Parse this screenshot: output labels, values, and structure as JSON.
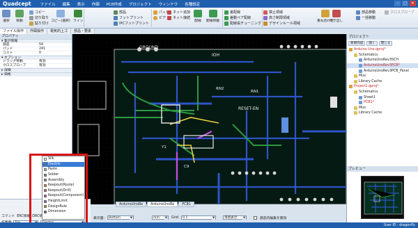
{
  "app": {
    "logo": "Quadcept",
    "menu": [
      "ファイル",
      "編集",
      "表示",
      "作図",
      "PCB作成",
      "プロジェクト",
      "ウィンドウ",
      "各種設定"
    ]
  },
  "ribbon": {
    "groups": [
      {
        "label": "選択"
      },
      {
        "label": "移動"
      },
      {
        "label": "コピー"
      },
      {
        "label": "切り取り"
      },
      {
        "label": "貼り付け"
      },
      {
        "label": "コピー(選択)"
      },
      {
        "label": "ライン"
      },
      {
        "label": "部品"
      },
      {
        "label": "フットプリント"
      },
      {
        "label": "IPCフットプリント"
      },
      {
        "label": "パッド"
      },
      {
        "label": "ビア"
      },
      {
        "label": "ネット追加"
      },
      {
        "label": "ネット接続"
      },
      {
        "label": "配線"
      },
      {
        "label": "配線移動"
      },
      {
        "label": "差配線"
      },
      {
        "label": "差動ペア配線"
      },
      {
        "label": "配線長チューニング"
      },
      {
        "label": "禁止領域"
      },
      {
        "label": "高さ制限領域"
      },
      {
        "label": "デザインルール領域"
      },
      {
        "label": "重ね合わせ"
      },
      {
        "label": "引き出し"
      },
      {
        "label": "部品移動"
      },
      {
        "label": "一括移動"
      },
      {
        "label": "クロスプローブ"
      }
    ]
  },
  "tabs": [
    "ファイル操作",
    "作図操作",
    "電気的上ゴ",
    "部品・要素"
  ],
  "properties": {
    "title": "プロパティ",
    "sections": [
      {
        "name": "集計情報",
        "rows": [
          {
            "k": "部品",
            "v": "54"
          },
          {
            "k": "パッド",
            "v": "241"
          },
          {
            "k": "コスト",
            "v": "0"
          }
        ]
      },
      {
        "name": "オプション",
        "rows": [
          {
            "k": "ドラッグ移動",
            "v": "有効"
          },
          {
            "k": "クロスプローブ",
            "v": "有効"
          }
        ]
      },
      {
        "name": "詳細",
        "rows": []
      },
      {
        "name": "価格",
        "rows": []
      }
    ]
  },
  "layer_dropdown": {
    "items": [
      "Silk",
      "Electric",
      "Paste",
      "Solder",
      "Assembly",
      "Keepout(Route)",
      "Keepout(Drill)",
      "Keepout(Component)",
      "HeightLimit",
      "DesignRule",
      "Dimension"
    ],
    "selected": "Electric",
    "swatch_colors": [
      "#ffffff",
      "#3a7bd5",
      "#b0b0b0",
      "#5b9b5b",
      "#909090",
      "#e38a2a",
      "#d65b5b",
      "#d64ea0",
      "#8c6cc7",
      "#c28f2d",
      "#6a6a6a"
    ]
  },
  "bottom_left": {
    "row1": [
      "コマンド",
      "ERC情報",
      "DRC情報",
      "MRC情報"
    ],
    "face_label": "作業面",
    "face_value": "Top",
    "layer_value": "Electric"
  },
  "doc_tabs": [
    "ArduinoUnoRe",
    "ArduinoUnoRe",
    "PCB1"
  ],
  "status": {
    "layer_label": "表示面:",
    "layer_value": "Bottom",
    "unit": "mm",
    "grid_label": "Grid",
    "grid_value": "0.1",
    "mode": "単新表示",
    "edit_label": "部品内編集を無効"
  },
  "bottombar": {
    "user": "User ID : dragonfly"
  },
  "project": {
    "title": "プロジェクト",
    "tools": [
      "新規作成",
      "開く",
      "閉じる"
    ],
    "tree": [
      {
        "text": "Arduino Uno.qproj*",
        "indent": 0,
        "red": true,
        "sel": false
      },
      {
        "text": "Schematics",
        "indent": 1,
        "red": false,
        "sel": false
      },
      {
        "text": "ArduinoUnoRev3SCH",
        "indent": 2,
        "red": false,
        "sel": false
      },
      {
        "text": "ArduinoUnoRev3PCB*",
        "indent": 2,
        "red": true,
        "sel": true
      },
      {
        "text": "ArduinoUnoRev3PCB_Panel",
        "indent": 2,
        "red": false,
        "sel": false
      },
      {
        "text": "Misc",
        "indent": 1,
        "red": false,
        "sel": false
      },
      {
        "text": "Library Cache",
        "indent": 1,
        "red": false,
        "sel": false
      },
      {
        "text": "Project1.qproj*",
        "indent": 0,
        "red": true,
        "sel": false
      },
      {
        "text": "Schematics",
        "indent": 1,
        "red": false,
        "sel": false
      },
      {
        "text": "Sheet1",
        "indent": 2,
        "red": false,
        "sel": false
      },
      {
        "text": "PCB1*",
        "indent": 2,
        "red": true,
        "sel": false
      },
      {
        "text": "Misc",
        "indent": 1,
        "red": false,
        "sel": false
      },
      {
        "text": "Library Cache",
        "indent": 1,
        "red": false,
        "sel": false
      }
    ]
  },
  "preview": {
    "title": "プレビュー"
  },
  "board_labels": {
    "ground": "GROUND",
    "ioh": "IOH",
    "rn2": "RN2",
    "rn1": "RN1",
    "reset_en": "RESET-EN",
    "y1": "Y1",
    "c9": "C9"
  },
  "colors": {
    "brand": "#1f5fae",
    "highlight": "#d81414",
    "selection": "#3a7bd5"
  }
}
